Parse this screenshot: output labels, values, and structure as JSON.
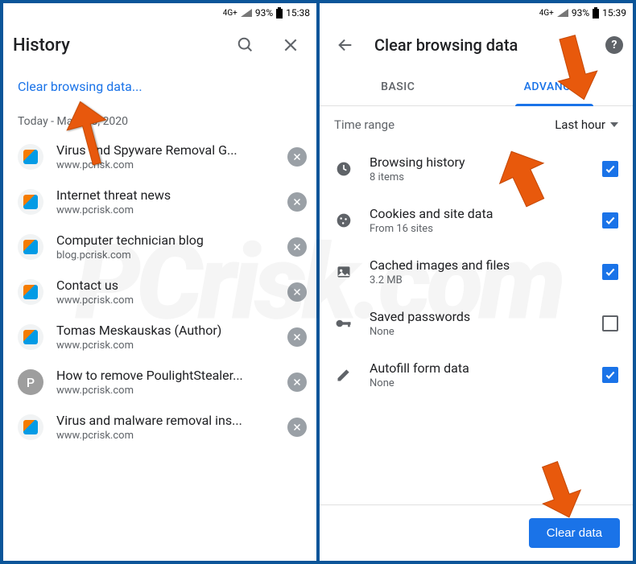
{
  "watermark": "PCrisk.com",
  "left": {
    "status": {
      "net": "4G+",
      "battery_pct": "93%",
      "time": "15:38"
    },
    "title": "History",
    "clear_link": "Clear browsing data...",
    "date_header": "Today - March 3, 2020",
    "items": [
      {
        "title": "Virus and Spyware Removal G...",
        "url": "www.pcrisk.com",
        "fav": "pcrisk"
      },
      {
        "title": "Internet threat news",
        "url": "www.pcrisk.com",
        "fav": "pcrisk"
      },
      {
        "title": "Computer technician blog",
        "url": "blog.pcrisk.com",
        "fav": "pcrisk"
      },
      {
        "title": "Contact us",
        "url": "www.pcrisk.com",
        "fav": "pcrisk"
      },
      {
        "title": "Tomas Meskauskas (Author)",
        "url": "www.pcrisk.com",
        "fav": "pcrisk"
      },
      {
        "title": "How to remove PoulightStealer...",
        "url": "www.pcrisk.com",
        "fav": "letter",
        "letter": "P"
      },
      {
        "title": "Virus and malware removal ins...",
        "url": "www.pcrisk.com",
        "fav": "pcrisk"
      }
    ]
  },
  "right": {
    "status": {
      "net": "4G+",
      "battery_pct": "93%",
      "time": "15:39"
    },
    "title": "Clear browsing data",
    "tabs": {
      "basic": "BASIC",
      "advanced": "ADVANCED"
    },
    "range_label": "Time range",
    "range_value": "Last hour",
    "options": [
      {
        "icon": "clock",
        "title": "Browsing history",
        "sub": "8 items",
        "checked": true
      },
      {
        "icon": "cookie",
        "title": "Cookies and site data",
        "sub": "From 16 sites",
        "checked": true
      },
      {
        "icon": "image",
        "title": "Cached images and files",
        "sub": "3.2 MB",
        "checked": true
      },
      {
        "icon": "key",
        "title": "Saved passwords",
        "sub": "None",
        "checked": false
      },
      {
        "icon": "pencil",
        "title": "Autofill form data",
        "sub": "None",
        "checked": true
      }
    ],
    "clear_btn": "Clear data"
  }
}
